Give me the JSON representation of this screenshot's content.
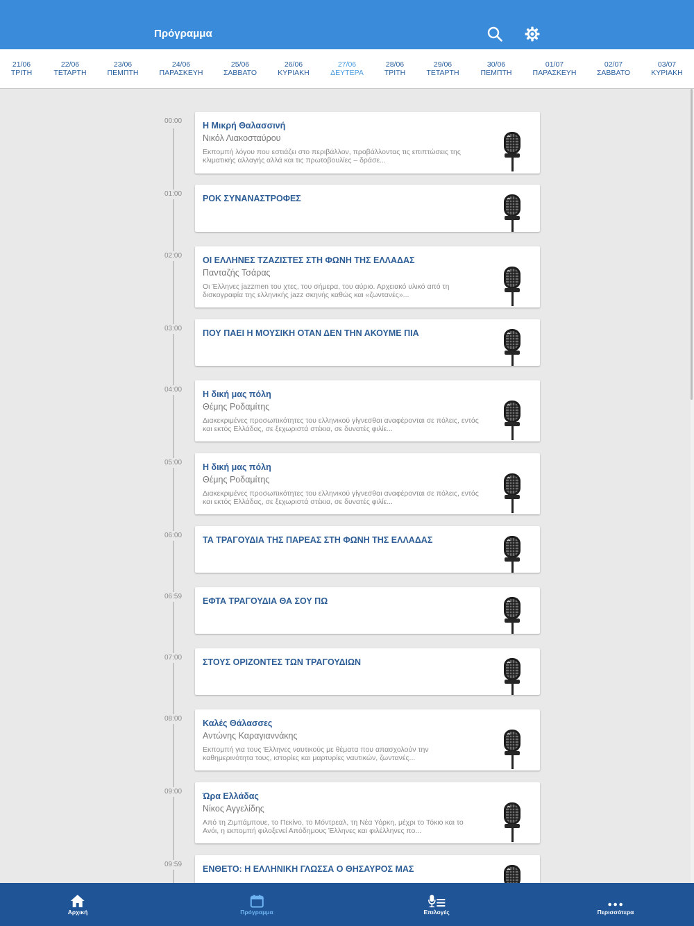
{
  "header": {
    "title": "Πρόγραμμα",
    "search_icon": "search-icon",
    "settings_icon": "gear-icon",
    "color": "#3b8bdb"
  },
  "dates": [
    {
      "date": "21/06",
      "day": "ΤΡΙΤΗ"
    },
    {
      "date": "22/06",
      "day": "ΤΕΤΑΡΤΗ"
    },
    {
      "date": "23/06",
      "day": "ΠΕΜΠΤΗ"
    },
    {
      "date": "24/06",
      "day": "ΠΑΡΑΣΚΕΥΗ"
    },
    {
      "date": "25/06",
      "day": "ΣΑΒΒΑΤΟ"
    },
    {
      "date": "26/06",
      "day": "ΚΥΡΙΑΚΗ"
    },
    {
      "date": "27/06",
      "day": "ΔΕΥΤΕΡΑ",
      "active": true
    },
    {
      "date": "28/06",
      "day": "ΤΡΙΤΗ"
    },
    {
      "date": "29/06",
      "day": "ΤΕΤΑΡΤΗ"
    },
    {
      "date": "30/06",
      "day": "ΠΕΜΠΤΗ"
    },
    {
      "date": "01/07",
      "day": "ΠΑΡΑΣΚΕΥΗ"
    },
    {
      "date": "02/07",
      "day": "ΣΑΒΒΑΤΟ"
    },
    {
      "date": "03/07",
      "day": "ΚΥΡΙΑΚΗ"
    }
  ],
  "programs": [
    {
      "time": "00:00",
      "title": "Η Μικρή Θαλασσινή",
      "host": "Νικόλ Λιακοσταύρου",
      "description": "Εκπομπή λόγου που εστιάζει στο περιβάλλον, προβάλλοντας τις επιπτώσεις της κλιματικής αλλαγής αλλά και τις πρωτοβουλίες – δράσε..."
    },
    {
      "time": "01:00",
      "title": "ΡΟΚ ΣΥΝΑΝΑΣΤΡΟΦΕΣ",
      "host": "",
      "description": ""
    },
    {
      "time": "02:00",
      "title": "ΟΙ ΕΛΛΗΝΕΣ ΤΖΑΖΙΣΤΕΣ ΣΤΗ ΦΩΝΗ ΤΗΣ ΕΛΛΑΔΑΣ",
      "host": "Πανταζής Τσάρας",
      "description": "Οι Έλληνες jazzmen του χτες, του σήμερα, του αύριο. Αρχειακό υλικό από τη δισκογραφία της ελληνικής jazz σκηνής καθώς και «ζωντανές»..."
    },
    {
      "time": "03:00",
      "title": "ΠΟΥ ΠΑΕΙ Η ΜΟΥΣΙΚΗ ΟΤΑΝ ΔΕΝ ΤΗΝ ΑΚΟΥΜΕ ΠΙΑ",
      "host": "",
      "description": ""
    },
    {
      "time": "04:00",
      "title": "Η δική μας πόλη",
      "host": "Θέμης Ροδαμίτης",
      "description": "Διακεκριμένες προσωπικότητες του ελληνικού γίγνεσθαι αναφέρονται σε πόλεις, εντός και εκτός Ελλάδας, σε ξεχωριστά στέκια, σε δυνατές φιλίε..."
    },
    {
      "time": "05:00",
      "title": "Η δική μας πόλη",
      "host": "Θέμης Ροδαμίτης",
      "description": "Διακεκριμένες προσωπικότητες του ελληνικού γίγνεσθαι αναφέρονται σε πόλεις, εντός και εκτός Ελλάδας, σε ξεχωριστά στέκια, σε δυνατές φιλίε..."
    },
    {
      "time": "06:00",
      "title": "ΤΑ ΤΡΑΓΟΥΔΙΑ ΤΗΣ ΠΑΡΕΑΣ ΣΤΗ ΦΩΝΗ ΤΗΣ ΕΛΛΑΔΑΣ",
      "host": "",
      "description": ""
    },
    {
      "time": "06:59",
      "title": "ΕΦΤΑ ΤΡΑΓΟΥΔΙΑ ΘΑ ΣΟΥ ΠΩ",
      "host": "",
      "description": ""
    },
    {
      "time": "07:00",
      "title": "ΣΤΟΥΣ ΟΡΙΖΟΝΤΕΣ ΤΩΝ ΤΡΑΓΟΥΔΙΩΝ",
      "host": "",
      "description": ""
    },
    {
      "time": "08:00",
      "title": "Καλές Θάλασσες",
      "host": "Αντώνης Καραγιαννάκης",
      "description": "Εκπομπή για τους Έλληνες ναυτικούς με θέματα που απασχολούν την καθημερινότητα τους, ιστορίες και μαρτυρίες ναυτικών, ζωντανές..."
    },
    {
      "time": "09:00",
      "title": "Ώρα Ελλάδας",
      "host": "Νίκος Αγγελίδης",
      "description": "Από τη Ζιμπάμπουε, το Πεκίνο, το Μόντρεαλ, τη Νέα Υόρκη, μέχρι το Τόκιο και το Ανόι, η εκπομπή φιλοξενεί Απόδημους Έλληνες και φιλέλληνες πο..."
    },
    {
      "time": "09:59",
      "title": "ΕΝΘΕΤΟ: Η ΕΛΛΗΝΙΚΗ ΓΛΩΣΣΑ Ο ΘΗΣΑΥΡΟΣ ΜΑΣ",
      "host": "",
      "description": ""
    }
  ],
  "program_icon": "microphone-icon",
  "bottom_nav": [
    {
      "label": "Αρχική",
      "icon": "home-icon"
    },
    {
      "label": "Πρόγραμμα",
      "icon": "calendar-icon",
      "active": true
    },
    {
      "label": "Επιλογές",
      "icon": "mic-list-icon"
    },
    {
      "label": "Περισσότερα",
      "icon": "more-icon"
    }
  ],
  "colors": {
    "accent": "#3b8bdb",
    "nav_bg": "#1f5496",
    "title_text": "#2d5d96",
    "active_nav": "#6fb4f2"
  }
}
